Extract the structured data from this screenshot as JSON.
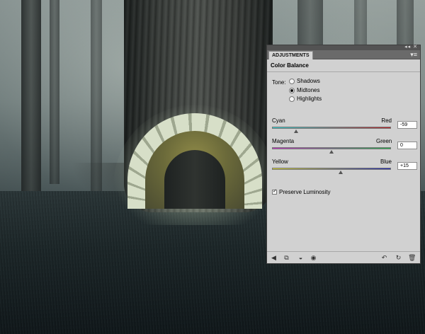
{
  "panel": {
    "tab_label": "ADJUSTMENTS",
    "topstrip_controls": "◂◂ ✕",
    "menu_icon": "▾≡",
    "title": "Color Balance"
  },
  "tone": {
    "label": "Tone:",
    "options": [
      {
        "label": "Shadows",
        "selected": false
      },
      {
        "label": "Midtones",
        "selected": true
      },
      {
        "label": "Highlights",
        "selected": false
      }
    ]
  },
  "sliders": [
    {
      "left": "Cyan",
      "right": "Red",
      "value": "-59",
      "position": -59
    },
    {
      "left": "Magenta",
      "right": "Green",
      "value": "0",
      "position": 0
    },
    {
      "left": "Yellow",
      "right": "Blue",
      "value": "+15",
      "position": 15
    }
  ],
  "preserve_luminosity": {
    "label": "Preserve Luminosity",
    "checked": true
  },
  "footer_icons": {
    "left": [
      "return-to-list-icon",
      "expand-view-icon",
      "clip-to-layer-icon",
      "visibility-icon"
    ],
    "right": [
      "previous-state-icon",
      "reset-icon",
      "delete-icon"
    ]
  },
  "colors": {
    "cyan": "#2fd1d2",
    "red": "#c01f24",
    "magenta": "#c830c8",
    "green": "#22b24a",
    "yellow": "#d6d22a",
    "blue": "#1d25b8",
    "panel_bg": "#d1d1d1"
  }
}
